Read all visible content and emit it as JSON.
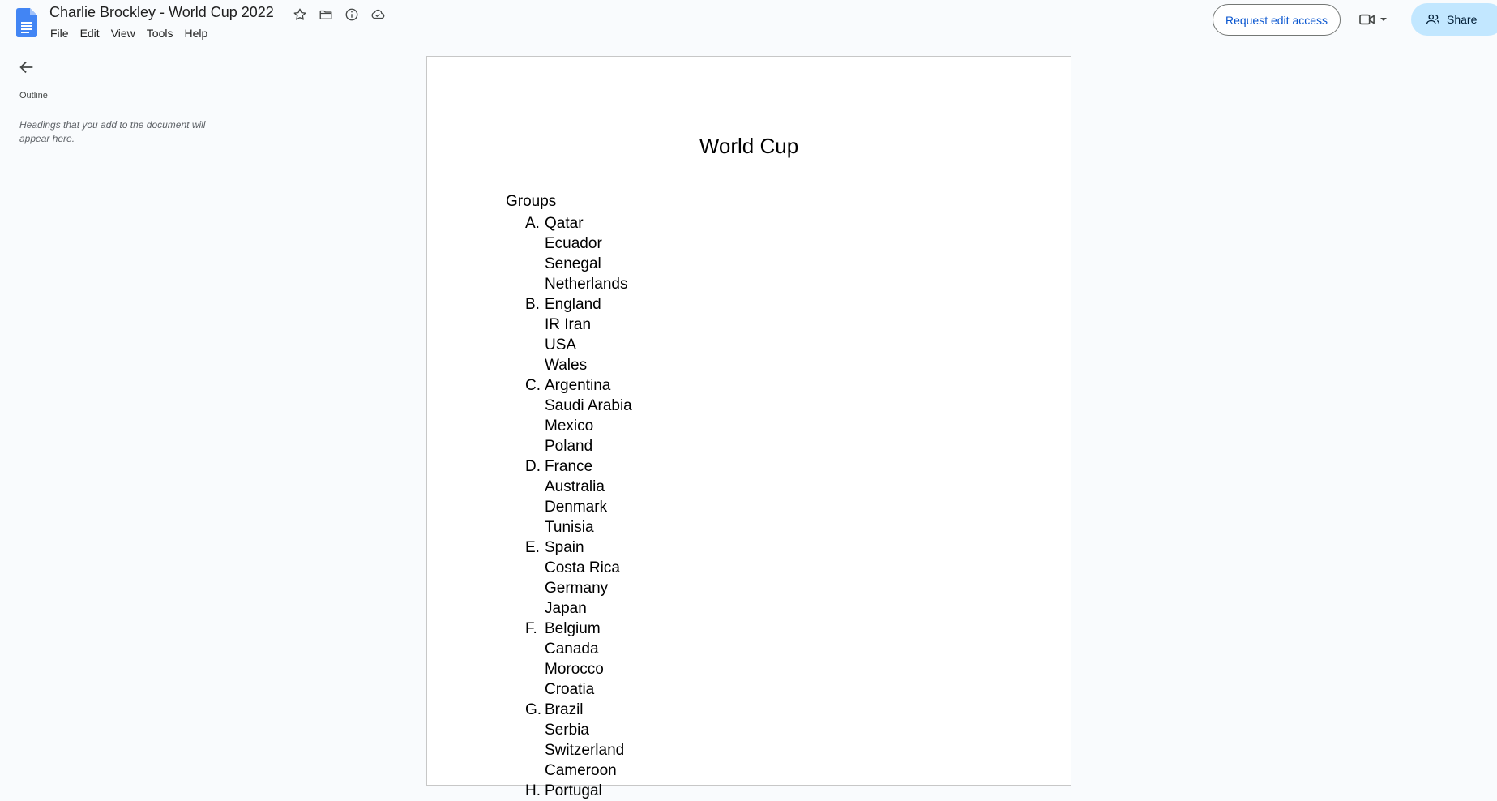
{
  "header": {
    "doc_title": "Charlie Brockley - World Cup 2022",
    "title_icons": [
      "star-icon",
      "folder-icon",
      "info-icon",
      "cloud-icon"
    ],
    "menu": [
      "File",
      "Edit",
      "View",
      "Tools",
      "Help"
    ],
    "request_edit_label": "Request edit access",
    "share_label": "Share"
  },
  "sidebar": {
    "outline_label": "Outline",
    "outline_hint": "Headings that you add to the document will appear here."
  },
  "document": {
    "title": "World Cup",
    "section_label": "Groups",
    "groups": [
      {
        "letter": "A.",
        "teams": [
          "Qatar",
          "Ecuador",
          "Senegal",
          "Netherlands"
        ]
      },
      {
        "letter": "B.",
        "teams": [
          "England",
          "IR Iran",
          "USA",
          "Wales"
        ]
      },
      {
        "letter": "C.",
        "teams": [
          "Argentina",
          "Saudi Arabia",
          "Mexico",
          "Poland"
        ]
      },
      {
        "letter": "D.",
        "teams": [
          "France",
          "Australia",
          "Denmark",
          "Tunisia"
        ]
      },
      {
        "letter": "E.",
        "teams": [
          "Spain",
          "Costa Rica",
          "Germany",
          "Japan"
        ]
      },
      {
        "letter": "F.",
        "teams": [
          "Belgium",
          "Canada",
          "Morocco",
          "Croatia"
        ]
      },
      {
        "letter": "G.",
        "teams": [
          "Brazil",
          "Serbia",
          "Switzerland",
          "Cameroon"
        ]
      },
      {
        "letter": "H.",
        "teams": [
          "Portugal"
        ]
      }
    ]
  },
  "colors": {
    "accent": "#0b57d0",
    "share_bg": "#c2e7ff",
    "docs_blue": "#4285f4"
  }
}
